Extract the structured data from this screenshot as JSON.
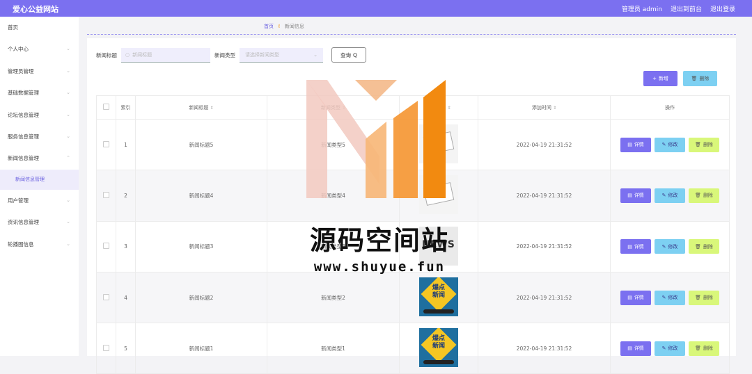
{
  "header": {
    "title": "爱心公益网站",
    "admin_label": "管理员 admin",
    "back_label": "退出到前台",
    "logout_label": "退出登录"
  },
  "sidebar": {
    "items": [
      {
        "label": "首页"
      },
      {
        "label": "个人中心"
      },
      {
        "label": "管理员管理"
      },
      {
        "label": "基础数据管理"
      },
      {
        "label": "论坛信息管理"
      },
      {
        "label": "服务信息管理"
      },
      {
        "label": "新闻信息管理"
      },
      {
        "label": "新闻信息管理"
      },
      {
        "label": "用户管理"
      },
      {
        "label": "资讯信息管理"
      },
      {
        "label": "轮播图信息"
      }
    ]
  },
  "breadcrumb": {
    "home": "首页",
    "current": "新闻信息"
  },
  "search": {
    "title_label": "新闻标题",
    "title_placeholder": "新闻标题",
    "type_label": "新闻类型",
    "type_placeholder": "请选择新闻类型",
    "query_label": "查询"
  },
  "actions": {
    "add_label": "新增",
    "delete_label": "删除"
  },
  "table": {
    "headers": [
      "索引",
      "新闻标题",
      "新闻类型",
      "新闻图片",
      "添加时间",
      "操作"
    ],
    "rows": [
      {
        "index": "1",
        "title": "新闻标题5",
        "type": "新闻类型5",
        "time": "2022-04-19 21:31:52"
      },
      {
        "index": "2",
        "title": "新闻标题4",
        "type": "新闻类型4",
        "time": "2022-04-19 21:31:52"
      },
      {
        "index": "3",
        "title": "新闻标题3",
        "type": "新闻类型3",
        "time": "2022-04-19 21:31:52"
      },
      {
        "index": "4",
        "title": "新闻标题2",
        "type": "新闻类型2",
        "time": "2022-04-19 21:31:52"
      },
      {
        "index": "5",
        "title": "新闻标题1",
        "type": "新闻类型1",
        "time": "2022-04-19 21:31:52"
      }
    ],
    "op_detail": "详情",
    "op_edit": "修改",
    "op_delete": "删除",
    "thumb_text": "爆点\n新闻",
    "thumb_news": "NEWS"
  },
  "watermark": {
    "text": "源码空间站",
    "url": "www.shuyue.fun"
  },
  "colors": {
    "primary": "#7b70f0",
    "info": "#7dd0f2",
    "warning": "#d9f77a"
  }
}
